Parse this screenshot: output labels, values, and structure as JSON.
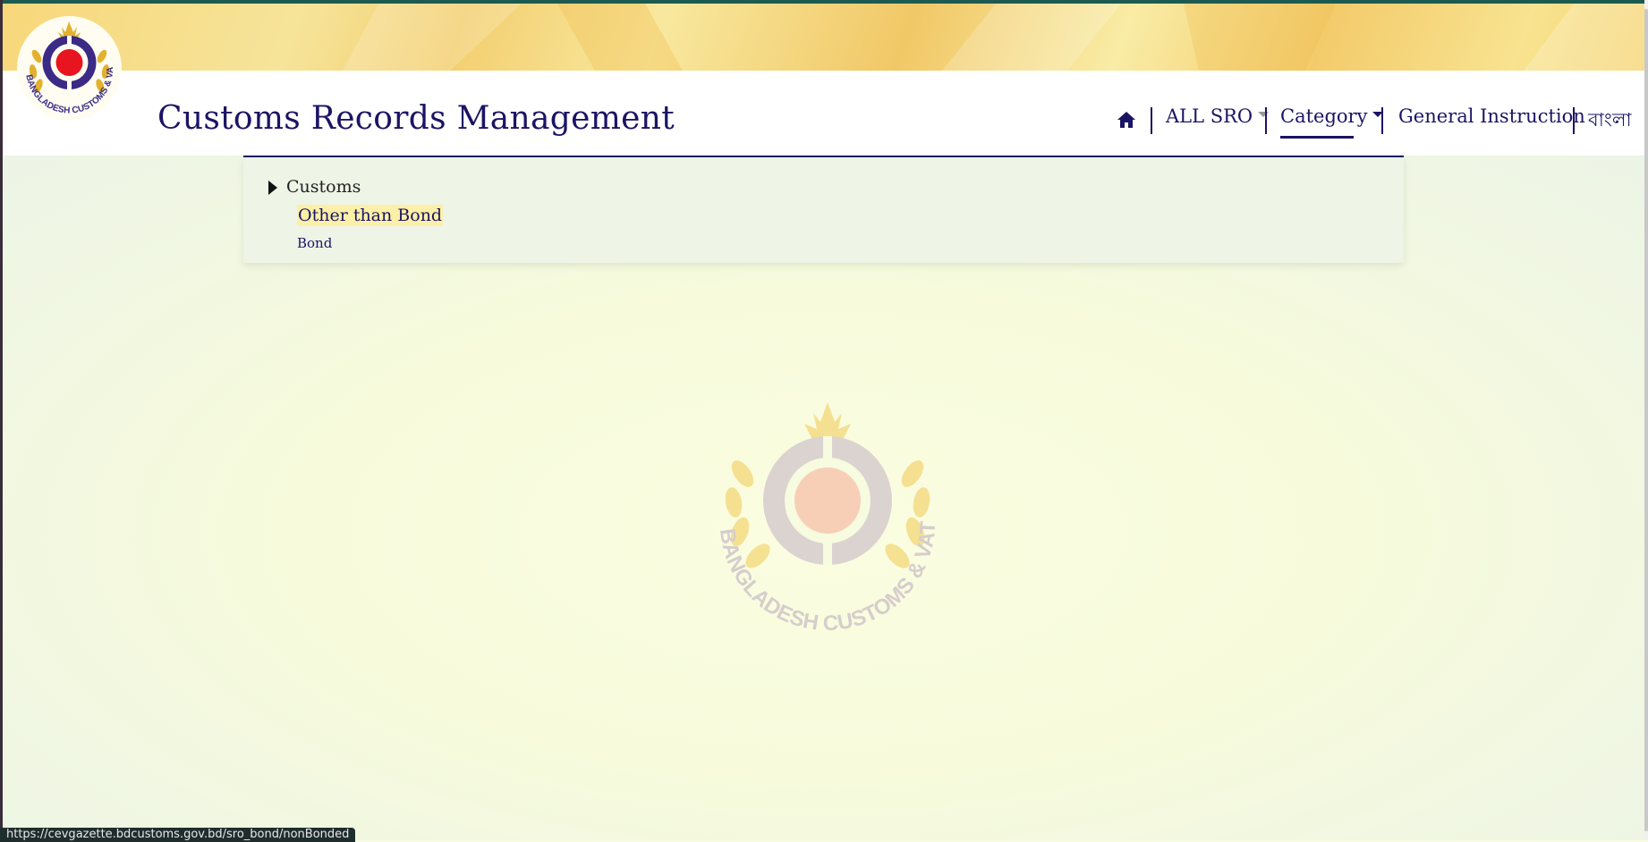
{
  "header": {
    "logo_text": "BANGLADESH CUSTOMS & VAT",
    "title": "Customs Records Management"
  },
  "nav": {
    "home_icon": "home-icon",
    "all_sro": "ALL SRO",
    "category": "Category",
    "general_instruction": "General Instruction",
    "language": "বাংলা"
  },
  "category_dropdown": {
    "root": "Customs",
    "children": [
      "Other than Bond",
      "Bond"
    ]
  },
  "watermark": {
    "text": "BANGLADESH CUSTOMS & VAT"
  },
  "status_bar": {
    "url": "https://cevgazette.bdcustoms.gov.bd/sro_bond/nonBonded"
  },
  "colors": {
    "primary": "#1b1464",
    "logo_red": "#e8141f",
    "logo_purple": "#3b2a86",
    "logo_gold": "#e2b22e",
    "highlight": "#fcf0a8"
  }
}
